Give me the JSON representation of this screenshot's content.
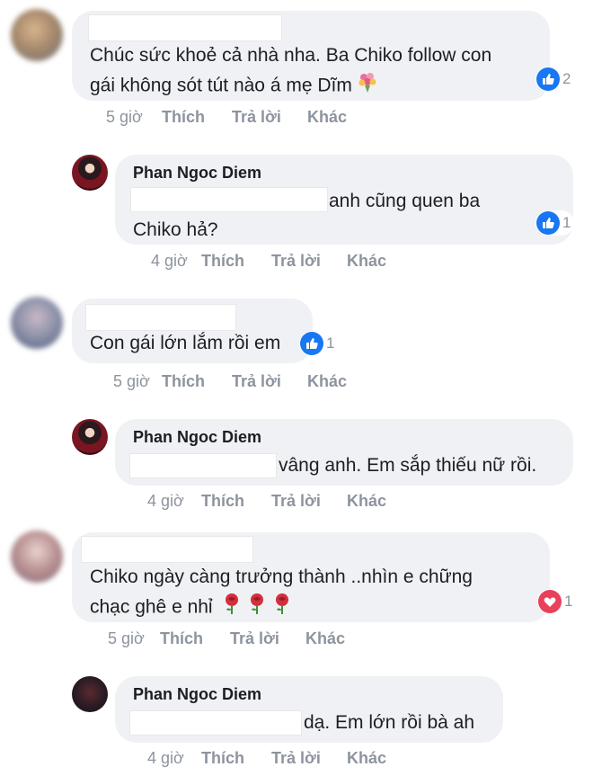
{
  "colors": {
    "like": "#1877f2",
    "love": "#e9405b",
    "bubble": "#f0f1f4",
    "meta": "#8d949e"
  },
  "actions": {
    "like": "Thích",
    "reply": "Trả lời",
    "more": "Khác"
  },
  "comments": [
    {
      "text": [
        "Chúc sức khoẻ cả nhà nha. Ba Chiko follow con",
        "gái không sót tút nào á mẹ Dĩm"
      ],
      "time": "5 giờ",
      "reaction": {
        "icon": "like-icon",
        "count": "2"
      }
    },
    {
      "name": "Phan Ngoc Diem",
      "text": [
        "anh cũng quen ba",
        "Chiko hả?"
      ],
      "time": "4 giờ",
      "reaction": {
        "icon": "like-icon",
        "count": "1"
      }
    },
    {
      "text": [
        "Con gái lớn lắm rồi em"
      ],
      "time": "5 giờ",
      "reaction": {
        "icon": "like-icon",
        "count": "1"
      }
    },
    {
      "name": "Phan Ngoc Diem",
      "text": [
        "vâng anh. Em sắp thiếu nữ rồi."
      ],
      "time": "4 giờ"
    },
    {
      "text": [
        "Chiko ngày càng trưởng thành ..nhìn e chững",
        "chạc ghê e nhỉ"
      ],
      "time": "5 giờ",
      "reaction": {
        "icon": "heart-icon",
        "count": "1"
      }
    },
    {
      "name": "Phan Ngoc Diem",
      "text": [
        "dạ. Em lớn rồi bà ah"
      ],
      "time": "4 giờ"
    }
  ]
}
